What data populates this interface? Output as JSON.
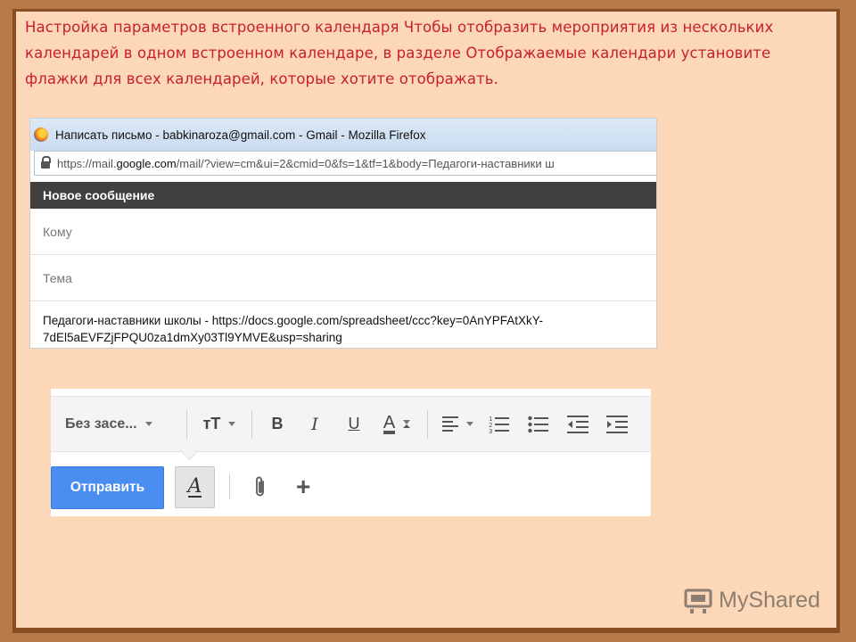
{
  "slide": {
    "caption": "Настройка параметров встроенного календаря Чтобы отобразить мероприятия из нескольких календарей в одном встроенном календаре, в разделе Отображаемые календари установите флажки для всех календарей, которые хотите отображать."
  },
  "browser": {
    "window_title": "Написать письмо - babkinaroza@gmail.com - Gmail - Mozilla Firefox",
    "url_prefix": "https://mail.",
    "url_domain": "google.com",
    "url_rest": "/mail/?view=cm&ui=2&cmid=0&fs=1&tf=1&body=Педагоги-наставники ш"
  },
  "compose": {
    "header": "Новое сообщение",
    "to_placeholder": "Кому",
    "subject_placeholder": "Тема",
    "body_line1": "Педагоги-наставники  школы - https://docs.google.com/spreadsheet/ccc?key=0AnYPFAtXkY-",
    "body_line2": "7dEl5aEVFZjFPQU0za1dmXy03Tl9YMVE&usp=sharing"
  },
  "toolbar": {
    "font_name": "Без засе...",
    "size_icon_label": "тT",
    "bold_label": "B",
    "italic_label": "I",
    "underline_label": "U",
    "text_color_label": "A",
    "send_label": "Отправить",
    "formatting_toggle_label": "A",
    "more_label": "+"
  },
  "watermark": {
    "text": "MyShared"
  },
  "colors": {
    "slide_bg": "#fcd7b8",
    "frame": "#b87a48",
    "caption": "#c8202a",
    "send_button": "#4a8df0"
  }
}
